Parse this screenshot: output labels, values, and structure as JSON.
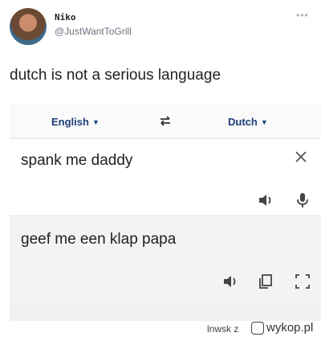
{
  "tweet": {
    "display_name": "Niko",
    "handle": "@JustWantToGrill",
    "more_icon": "ellipsis-icon",
    "text": "dutch is not a serious language"
  },
  "translator": {
    "source_language": "English",
    "target_language": "Dutch",
    "source_text": "spank me daddy",
    "translated_text": "geef me een klap papa",
    "icons": {
      "swap": "swap-arrows-icon",
      "clear": "close-icon",
      "listen_source": "speaker-icon",
      "mic": "microphone-icon",
      "listen_target": "speaker-icon",
      "copy": "copy-icon",
      "fullscreen": "fullscreen-icon"
    },
    "accent_color": "#1c3d78"
  },
  "watermark": {
    "prefix": "lnwsk z",
    "brand": "wykop.pl"
  }
}
